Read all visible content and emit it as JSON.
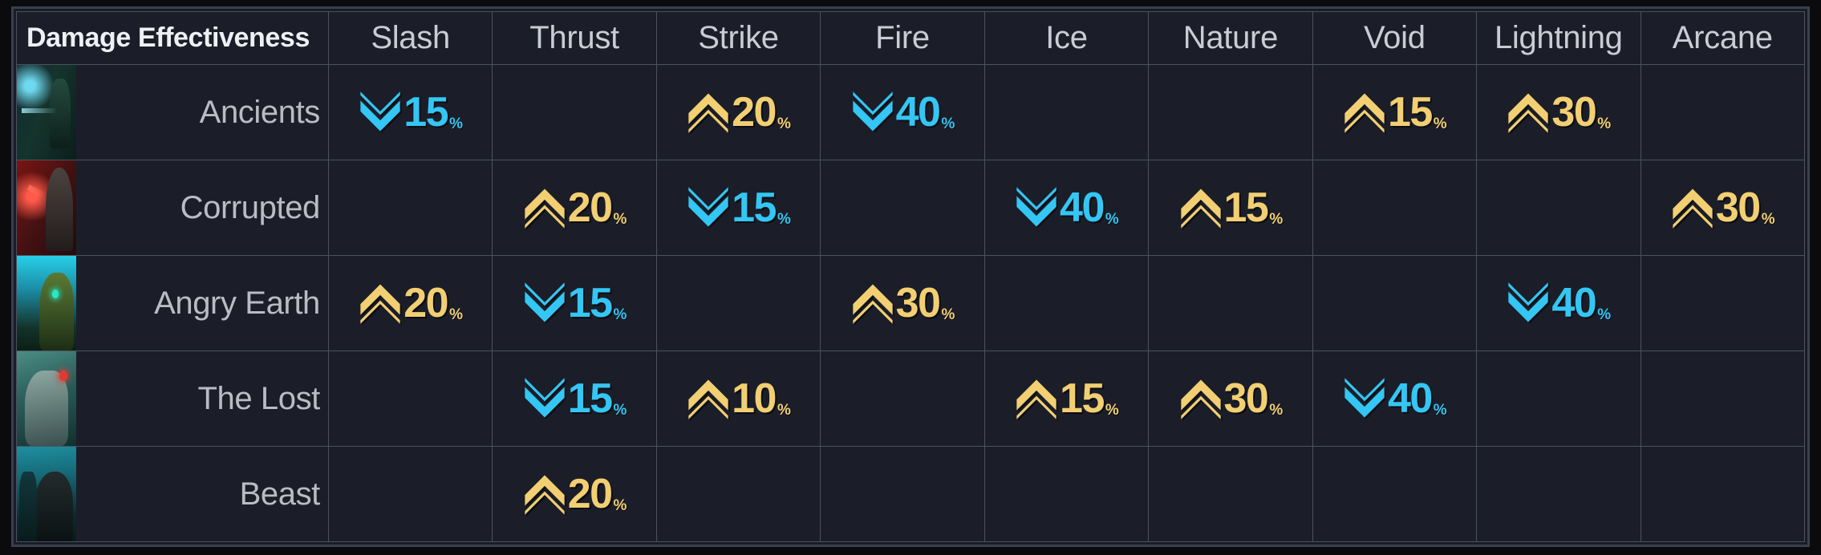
{
  "table": {
    "corner_label": "Damage Effectiveness",
    "columns": [
      "Slash",
      "Thrust",
      "Strike",
      "Fire",
      "Ice",
      "Nature",
      "Void",
      "Lightning",
      "Arcane"
    ],
    "percent_suffix": "%",
    "colors": {
      "increase": "#f2cf72",
      "decrease": "#34c6f4",
      "background": "#1b1e29",
      "grid": "#4c515e",
      "header_text": "#c9ccd4",
      "corner_text": "#eef0f4",
      "row_label_text": "#b9bcc4",
      "frame": "#3a3f4d",
      "page_background": "#0b0b0d"
    },
    "icons": {
      "increase": "double-chevron-up-icon",
      "decrease": "double-chevron-down-icon"
    },
    "rows": [
      {
        "name": "Ancients",
        "thumb": "art-ancients",
        "thumb_name": "ancients-thumbnail",
        "cells": [
          {
            "dir": "down",
            "value": "15"
          },
          {
            "dir": "none",
            "value": ""
          },
          {
            "dir": "up",
            "value": "20"
          },
          {
            "dir": "down",
            "value": "40"
          },
          {
            "dir": "none",
            "value": ""
          },
          {
            "dir": "none",
            "value": ""
          },
          {
            "dir": "up",
            "value": "15"
          },
          {
            "dir": "up",
            "value": "30"
          },
          {
            "dir": "none",
            "value": ""
          }
        ]
      },
      {
        "name": "Corrupted",
        "thumb": "art-corrupted",
        "thumb_name": "corrupted-thumbnail",
        "cells": [
          {
            "dir": "none",
            "value": ""
          },
          {
            "dir": "up",
            "value": "20"
          },
          {
            "dir": "down",
            "value": "15"
          },
          {
            "dir": "none",
            "value": ""
          },
          {
            "dir": "down",
            "value": "40"
          },
          {
            "dir": "up",
            "value": "15"
          },
          {
            "dir": "none",
            "value": ""
          },
          {
            "dir": "none",
            "value": ""
          },
          {
            "dir": "up",
            "value": "30"
          }
        ]
      },
      {
        "name": "Angry Earth",
        "thumb": "art-angryearth",
        "thumb_name": "angry-earth-thumbnail",
        "cells": [
          {
            "dir": "up",
            "value": "20"
          },
          {
            "dir": "down",
            "value": "15"
          },
          {
            "dir": "none",
            "value": ""
          },
          {
            "dir": "up",
            "value": "30"
          },
          {
            "dir": "none",
            "value": ""
          },
          {
            "dir": "none",
            "value": ""
          },
          {
            "dir": "none",
            "value": ""
          },
          {
            "dir": "down",
            "value": "40"
          },
          {
            "dir": "none",
            "value": ""
          }
        ]
      },
      {
        "name": "The Lost",
        "thumb": "art-thelost",
        "thumb_name": "the-lost-thumbnail",
        "cells": [
          {
            "dir": "none",
            "value": ""
          },
          {
            "dir": "down",
            "value": "15"
          },
          {
            "dir": "up",
            "value": "10"
          },
          {
            "dir": "none",
            "value": ""
          },
          {
            "dir": "up",
            "value": "15"
          },
          {
            "dir": "up",
            "value": "30"
          },
          {
            "dir": "down",
            "value": "40"
          },
          {
            "dir": "none",
            "value": ""
          },
          {
            "dir": "none",
            "value": ""
          }
        ]
      },
      {
        "name": "Beast",
        "thumb": "art-beast",
        "thumb_name": "beast-thumbnail",
        "cells": [
          {
            "dir": "none",
            "value": ""
          },
          {
            "dir": "up",
            "value": "20"
          },
          {
            "dir": "none",
            "value": ""
          },
          {
            "dir": "none",
            "value": ""
          },
          {
            "dir": "none",
            "value": ""
          },
          {
            "dir": "none",
            "value": ""
          },
          {
            "dir": "none",
            "value": ""
          },
          {
            "dir": "none",
            "value": ""
          },
          {
            "dir": "none",
            "value": ""
          }
        ]
      }
    ]
  }
}
